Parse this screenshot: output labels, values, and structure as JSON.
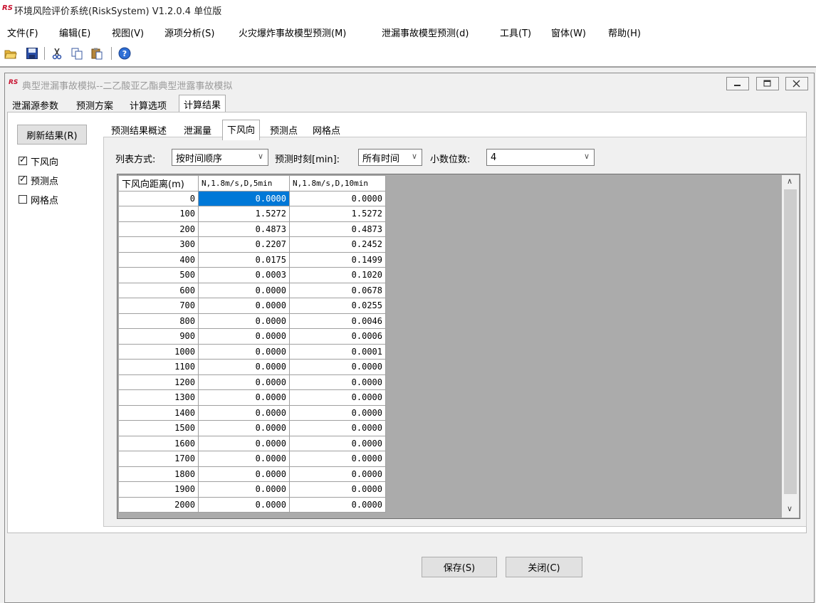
{
  "app": {
    "logo": "RS",
    "title": "环境风险评价系统(RiskSystem) V1.2.0.4 单位版"
  },
  "menu": [
    "文件(F)",
    "编辑(E)",
    "视图(V)",
    "源项分析(S)",
    "火灾爆炸事故模型预测(M)",
    "泄漏事故模型预测(d)",
    "工具(T)",
    "窗体(W)",
    "帮助(H)"
  ],
  "toolbar": [
    "open-folder-icon",
    "save-icon",
    "cut-icon",
    "copy-icon",
    "paste-icon",
    "help-icon"
  ],
  "child": {
    "logo": "RS",
    "title": "典型泄漏事故模拟--二乙酸亚乙酯典型泄露事故模拟"
  },
  "tabs": [
    "泄漏源参数",
    "预测方案",
    "计算选项",
    "计算结果"
  ],
  "left": {
    "refresh": "刷新结果(R)",
    "checks": [
      {
        "label": "下风向",
        "checked": true
      },
      {
        "label": "预测点",
        "checked": true
      },
      {
        "label": "网格点",
        "checked": false
      }
    ]
  },
  "inner_tabs": [
    "预测结果概述",
    "泄漏量",
    "下风向",
    "预测点",
    "网格点"
  ],
  "options": {
    "list_label": "列表方式:",
    "list_value": "按时间顺序",
    "time_label": "预测时刻[min]:",
    "time_value": "所有时间",
    "decimals_label": "小数位数:",
    "decimals_value": "4"
  },
  "grid": {
    "headers": [
      "下风向距离(m)",
      "N,1.8m/s,D,5min",
      "N,1.8m/s,D,10min"
    ],
    "rows": [
      [
        "0",
        "0.0000",
        "0.0000"
      ],
      [
        "100",
        "1.5272",
        "1.5272"
      ],
      [
        "200",
        "0.4873",
        "0.4873"
      ],
      [
        "300",
        "0.2207",
        "0.2452"
      ],
      [
        "400",
        "0.0175",
        "0.1499"
      ],
      [
        "500",
        "0.0003",
        "0.1020"
      ],
      [
        "600",
        "0.0000",
        "0.0678"
      ],
      [
        "700",
        "0.0000",
        "0.0255"
      ],
      [
        "800",
        "0.0000",
        "0.0046"
      ],
      [
        "900",
        "0.0000",
        "0.0006"
      ],
      [
        "1000",
        "0.0000",
        "0.0001"
      ],
      [
        "1100",
        "0.0000",
        "0.0000"
      ],
      [
        "1200",
        "0.0000",
        "0.0000"
      ],
      [
        "1300",
        "0.0000",
        "0.0000"
      ],
      [
        "1400",
        "0.0000",
        "0.0000"
      ],
      [
        "1500",
        "0.0000",
        "0.0000"
      ],
      [
        "1600",
        "0.0000",
        "0.0000"
      ],
      [
        "1700",
        "0.0000",
        "0.0000"
      ],
      [
        "1800",
        "0.0000",
        "0.0000"
      ],
      [
        "1900",
        "0.0000",
        "0.0000"
      ],
      [
        "2000",
        "0.0000",
        "0.0000"
      ]
    ]
  },
  "buttons": {
    "save": "保存(S)",
    "close": "关闭(C)"
  }
}
